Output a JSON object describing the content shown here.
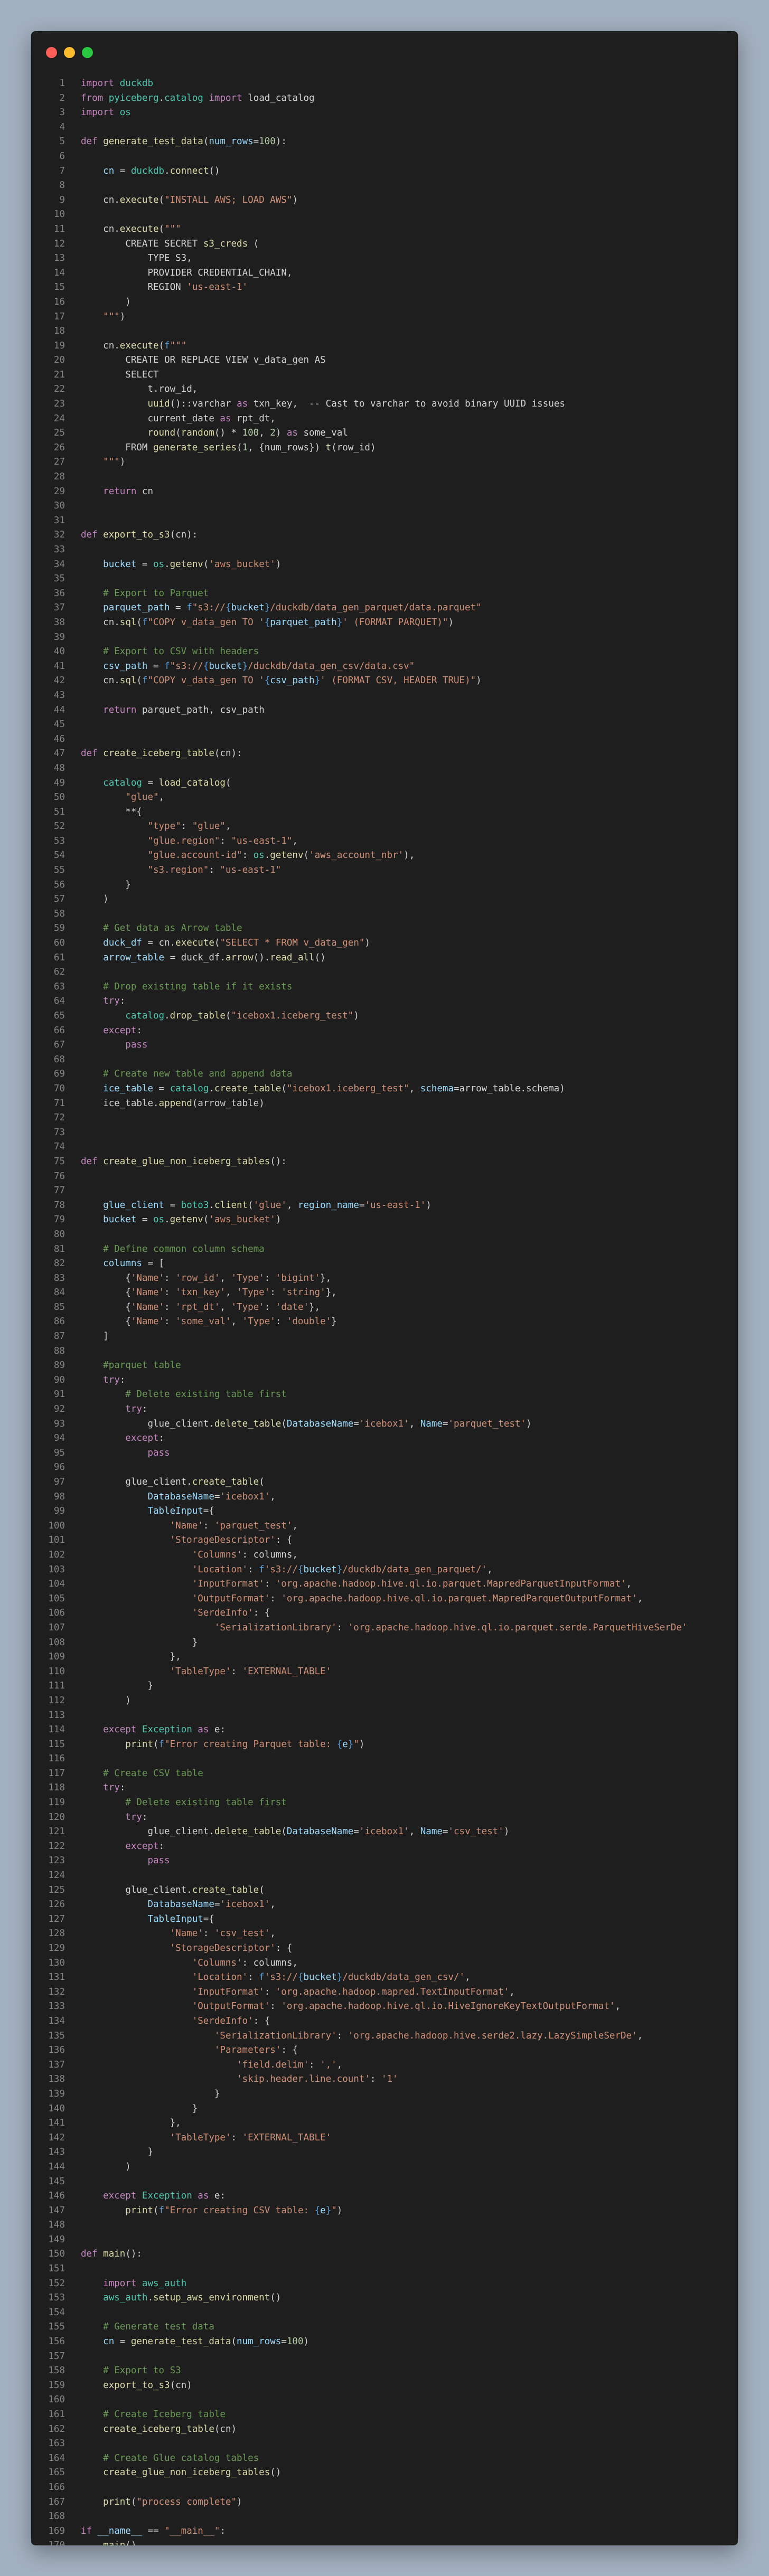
{
  "colors": {
    "close": "#ff5f57",
    "minimize": "#febc2e",
    "maximize": "#28c840"
  },
  "syntax": {
    "kw": "#c586c0",
    "def": "#569cd6",
    "fn": "#dcdcaa",
    "mod": "#4ec9b0",
    "str": "#ce9178",
    "cmt": "#6a9955",
    "var": "#9cdcfe",
    "num": "#b5cea8",
    "plain": "#d4d4d4"
  },
  "code_lines": [
    "import duckdb",
    "from pyiceberg.catalog import load_catalog",
    "import os",
    "",
    "def generate_test_data(num_rows=100):",
    "",
    "    cn = duckdb.connect()",
    "",
    "    cn.execute(\"INSTALL AWS; LOAD AWS\")",
    "",
    "    cn.execute(\"\"\"",
    "        CREATE SECRET s3_creds (",
    "            TYPE S3,",
    "            PROVIDER CREDENTIAL_CHAIN,",
    "            REGION 'us-east-1'",
    "        )",
    "    \"\"\")",
    "",
    "    cn.execute(f\"\"\"",
    "        CREATE OR REPLACE VIEW v_data_gen AS",
    "        SELECT",
    "            t.row_id,",
    "            uuid()::varchar as txn_key,  -- Cast to varchar to avoid binary UUID issues",
    "            current_date as rpt_dt,",
    "            round(random() * 100, 2) as some_val",
    "        FROM generate_series(1, {num_rows}) t(row_id)",
    "    \"\"\")",
    "",
    "    return cn",
    "",
    "",
    "def export_to_s3(cn):",
    "",
    "    bucket = os.getenv('aws_bucket')",
    "",
    "    # Export to Parquet",
    "    parquet_path = f\"s3://{bucket}/duckdb/data_gen_parquet/data.parquet\"",
    "    cn.sql(f\"COPY v_data_gen TO '{parquet_path}' (FORMAT PARQUET)\")",
    "",
    "    # Export to CSV with headers",
    "    csv_path = f\"s3://{bucket}/duckdb/data_gen_csv/data.csv\"",
    "    cn.sql(f\"COPY v_data_gen TO '{csv_path}' (FORMAT CSV, HEADER TRUE)\")",
    "",
    "    return parquet_path, csv_path",
    "",
    "",
    "def create_iceberg_table(cn):",
    "",
    "    catalog = load_catalog(",
    "        \"glue\",",
    "        **{",
    "            \"type\": \"glue\",",
    "            \"glue.region\": \"us-east-1\",",
    "            \"glue.account-id\": os.getenv('aws_account_nbr'),",
    "            \"s3.region\": \"us-east-1\"",
    "        }",
    "    )",
    "",
    "    # Get data as Arrow table",
    "    duck_df = cn.execute(\"SELECT * FROM v_data_gen\")",
    "    arrow_table = duck_df.arrow().read_all()",
    "",
    "    # Drop existing table if it exists",
    "    try:",
    "        catalog.drop_table(\"icebox1.iceberg_test\")",
    "    except:",
    "        pass",
    "",
    "    # Create new table and append data",
    "    ice_table = catalog.create_table(\"icebox1.iceberg_test\", schema=arrow_table.schema)",
    "    ice_table.append(arrow_table)",
    "",
    "",
    "",
    "def create_glue_non_iceberg_tables():",
    "",
    "",
    "    glue_client = boto3.client('glue', region_name='us-east-1')",
    "    bucket = os.getenv('aws_bucket')",
    "",
    "    # Define common column schema",
    "    columns = [",
    "        {'Name': 'row_id', 'Type': 'bigint'},",
    "        {'Name': 'txn_key', 'Type': 'string'},",
    "        {'Name': 'rpt_dt', 'Type': 'date'},",
    "        {'Name': 'some_val', 'Type': 'double'}",
    "    ]",
    "",
    "    #parquet table",
    "    try:",
    "        # Delete existing table first",
    "        try:",
    "            glue_client.delete_table(DatabaseName='icebox1', Name='parquet_test')",
    "        except:",
    "            pass",
    "",
    "        glue_client.create_table(",
    "            DatabaseName='icebox1',",
    "            TableInput={",
    "                'Name': 'parquet_test',",
    "                'StorageDescriptor': {",
    "                    'Columns': columns,",
    "                    'Location': f's3://{bucket}/duckdb/data_gen_parquet/',",
    "                    'InputFormat': 'org.apache.hadoop.hive.ql.io.parquet.MapredParquetInputFormat',",
    "                    'OutputFormat': 'org.apache.hadoop.hive.ql.io.parquet.MapredParquetOutputFormat',",
    "                    'SerdeInfo': {",
    "                        'SerializationLibrary': 'org.apache.hadoop.hive.ql.io.parquet.serde.ParquetHiveSerDe'",
    "                    }",
    "                },",
    "                'TableType': 'EXTERNAL_TABLE'",
    "            }",
    "        )",
    "",
    "    except Exception as e:",
    "        print(f\"Error creating Parquet table: {e}\")",
    "",
    "    # Create CSV table",
    "    try:",
    "        # Delete existing table first",
    "        try:",
    "            glue_client.delete_table(DatabaseName='icebox1', Name='csv_test')",
    "        except:",
    "            pass",
    "",
    "        glue_client.create_table(",
    "            DatabaseName='icebox1',",
    "            TableInput={",
    "                'Name': 'csv_test',",
    "                'StorageDescriptor': {",
    "                    'Columns': columns,",
    "                    'Location': f's3://{bucket}/duckdb/data_gen_csv/',",
    "                    'InputFormat': 'org.apache.hadoop.mapred.TextInputFormat',",
    "                    'OutputFormat': 'org.apache.hadoop.hive.ql.io.HiveIgnoreKeyTextOutputFormat',",
    "                    'SerdeInfo': {",
    "                        'SerializationLibrary': 'org.apache.hadoop.hive.serde2.lazy.LazySimpleSerDe',",
    "                        'Parameters': {",
    "                            'field.delim': ',',",
    "                            'skip.header.line.count': '1'",
    "                        }",
    "                    }",
    "                },",
    "                'TableType': 'EXTERNAL_TABLE'",
    "            }",
    "        )",
    "",
    "    except Exception as e:",
    "        print(f\"Error creating CSV table: {e}\")",
    "",
    "",
    "def main():",
    "",
    "    import aws_auth",
    "    aws_auth.setup_aws_environment()",
    "",
    "    # Generate test data",
    "    cn = generate_test_data(num_rows=100)",
    "",
    "    # Export to S3",
    "    export_to_s3(cn)",
    "",
    "    # Create Iceberg table",
    "    create_iceberg_table(cn)",
    "",
    "    # Create Glue catalog tables",
    "    create_glue_non_iceberg_tables()",
    "",
    "    print(\"process complete\")",
    "",
    "if __name__ == \"__main__\":",
    "    main()"
  ]
}
